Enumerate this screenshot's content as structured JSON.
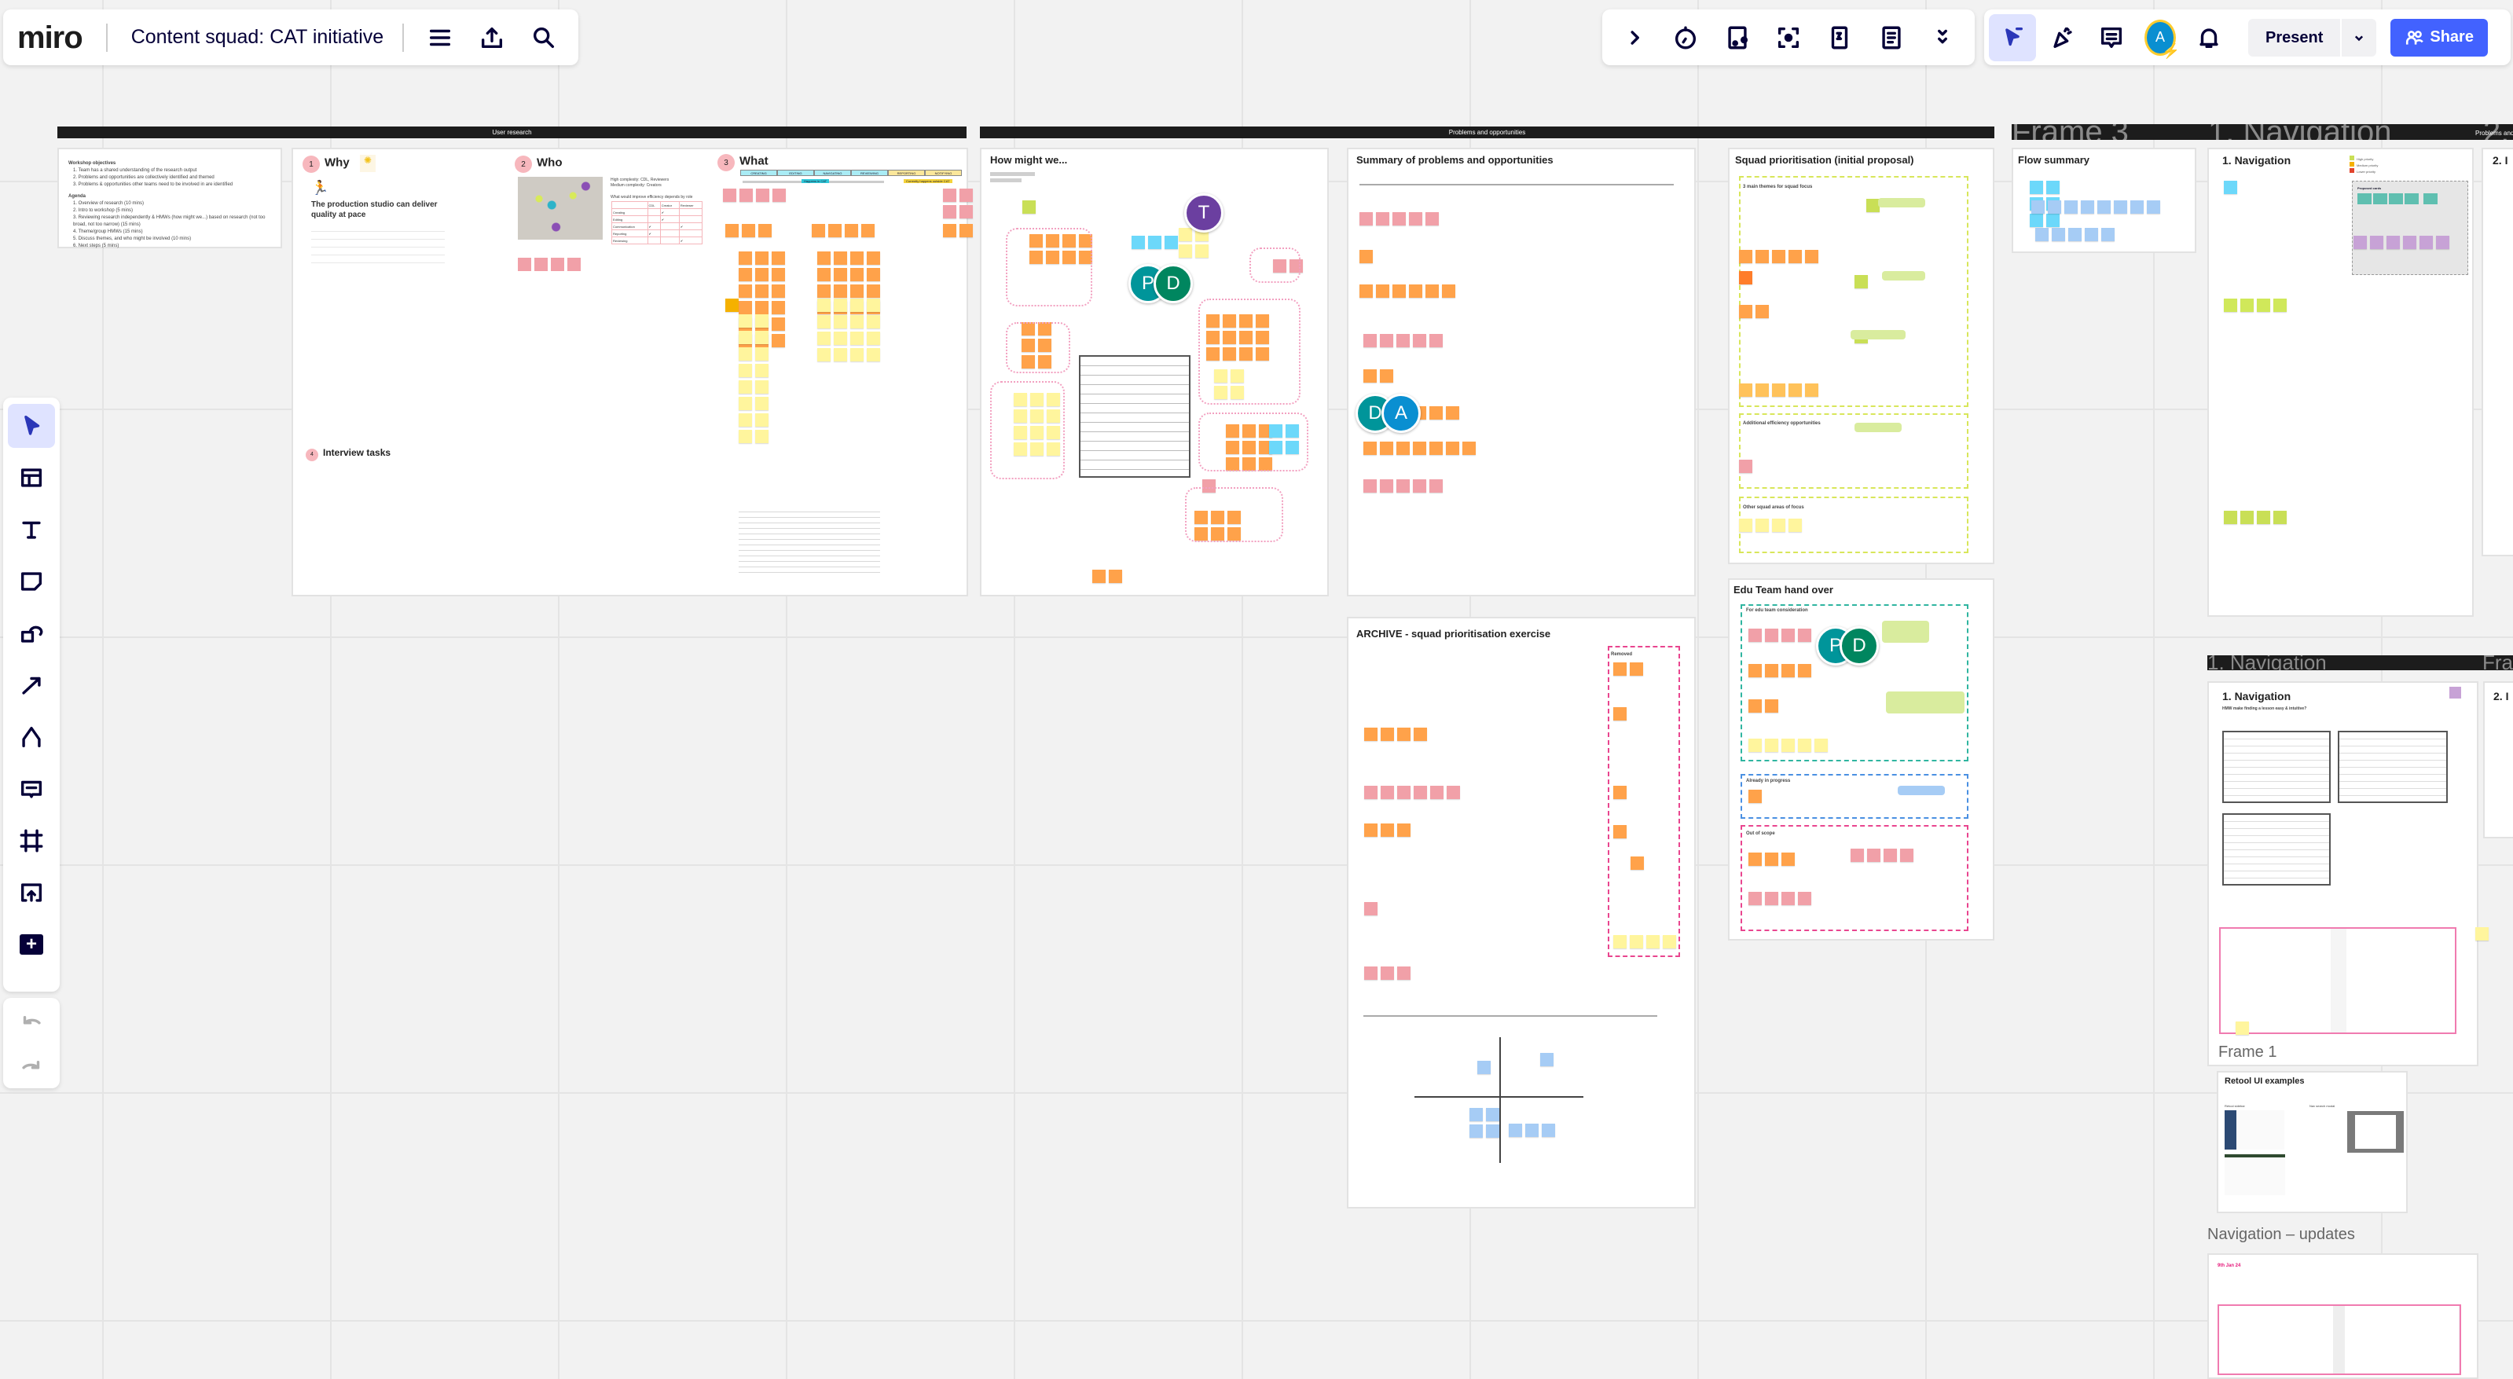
{
  "topbar": {
    "logo": "miro",
    "board_title": "Content squad: CAT initiative",
    "present_label": "Present",
    "share_label": "Share",
    "user_initial": "A"
  },
  "icons": {
    "left": [
      "menu-icon",
      "export-icon",
      "search-icon"
    ],
    "right": [
      "chevron-right-icon",
      "timer-icon",
      "video-icon",
      "screen-capture-icon",
      "card-icon",
      "notes-icon",
      "chevrons-down-icon",
      "cursor-follow-icon",
      "celebrate-icon",
      "comments-icon",
      "bell-icon"
    ],
    "tools": [
      "select-icon",
      "templates-icon",
      "text-icon",
      "sticky-note-icon",
      "shapes-icon",
      "arrow-icon",
      "pen-icon",
      "comment-icon",
      "frame-icon",
      "upload-icon",
      "more-icon",
      "undo-icon",
      "redo-icon"
    ]
  },
  "colors": {
    "accent": "#4262ff",
    "select_bg": "#dfe3ff",
    "sticky_pink": "#f1a0a8",
    "sticky_orange": "#ffa24a",
    "sticky_yellow": "#fff59d",
    "sticky_blue": "#a6ccf5",
    "sticky_cyan": "#6cd8fa",
    "sticky_green": "#c9df56",
    "cursor_teal": "#00959a",
    "cursor_purple": "#6b3fa0"
  },
  "sections": {
    "user_research": "User research",
    "problems": "Problems and opportunities",
    "right_band": [
      "Frame 3",
      "1. Navigation",
      "2. In"
    ],
    "right_band_tag": "Problems and opp",
    "lower_band": [
      "1. Navigation",
      "Fran"
    ]
  },
  "workshop": {
    "objectives_title": "Workshop objectives",
    "objectives": [
      "1. Team has a shared understanding of the research output",
      "2. Problems and opportunities are collectively identified and themed",
      "3. Problems & opportunities other teams need to be involved in are identified"
    ],
    "agenda_title": "Agenda",
    "agenda": [
      "1. Overview of research (10 mins)",
      "2. Intro to workshop (5 mins)",
      "3. Reviewing research independently & HMWs (how might we...) based on research (not too broad, not too narrow) (15 mins)",
      "4. Theme/group HMWs (15 mins)",
      "5. Discuss themes, and who might be involved (10 mins)",
      "6. Next steps (5 mins)"
    ]
  },
  "research": {
    "why": "Why",
    "who": "Who",
    "what": "What",
    "n1": "1",
    "n2": "2",
    "n3": "3",
    "n4": "4",
    "statement": "The production studio can deliver quality at pace",
    "who_complexity": [
      "High complexity: CDL, Reviewers",
      "Medium complexity: Creators"
    ],
    "who_table_title": "What would improve efficiency depends by role",
    "who_table_head": [
      "",
      "CDL",
      "Creator",
      "Reviewer"
    ],
    "who_table_rows": [
      [
        "Creating",
        "",
        "✔",
        ""
      ],
      [
        "Editing",
        "",
        "✔",
        ""
      ],
      [
        "Communication",
        "✔",
        "",
        "✔"
      ],
      [
        "Reporting",
        "✔",
        "",
        ""
      ],
      [
        "Reviewing",
        "",
        "",
        "✔"
      ]
    ],
    "what_columns": [
      "CREATING",
      "EDITING",
      "NAVIGATING",
      "REVIEWING",
      "REPORTING",
      "NOTIFYING"
    ],
    "in_cat": "Happens in CAT",
    "outside_cat": "Currently happens outside CAT",
    "interview_tasks": "Interview tasks"
  },
  "frames": {
    "hmw": "How might we...",
    "summary": "Summary of problems and opportunities",
    "squad": "Squad prioritisation (initial proposal)",
    "squad_sections": [
      "3 main themes for squad focus",
      "Additional efficiency opportunities",
      "Other squad areas of focus"
    ],
    "flow": "Flow summary",
    "nav1": "1. Navigation",
    "nav_legend": [
      "High priority",
      "Medium priority",
      "Lower priority"
    ],
    "proposed_cards": "Proposed cards",
    "nav2": "2. I",
    "archive": "ARCHIVE - squad prioritisation exercise",
    "removed": "Removed",
    "edu": "Edu Team hand over",
    "edu_sections": [
      "For edu team consideration",
      "Already in progress",
      "Out of scope"
    ],
    "nav_lower": "1. Navigation",
    "nav_lower_sub": "HMW make finding a lesson easy & intuitive?",
    "nav2_lower": "2. I",
    "frame1_label": "Frame 1",
    "retool": "Retool UI examples",
    "retool_sidebar": "Retool sidebar",
    "nav_search": "Nav search modal",
    "nav_updates_label": "Navigation – updates",
    "nav_updates_date": "9th Jan 24"
  },
  "cursors": [
    {
      "initial": "T",
      "color": "#6b3fa0"
    },
    {
      "initial": "P",
      "color": "#00959a"
    },
    {
      "initial": "D",
      "color": "#00865f"
    },
    {
      "initial": "D",
      "color": "#00959a"
    },
    {
      "initial": "A",
      "color": "#0a8fd1"
    },
    {
      "initial": "P",
      "color": "#00959a"
    },
    {
      "initial": "D",
      "color": "#00865f"
    }
  ]
}
